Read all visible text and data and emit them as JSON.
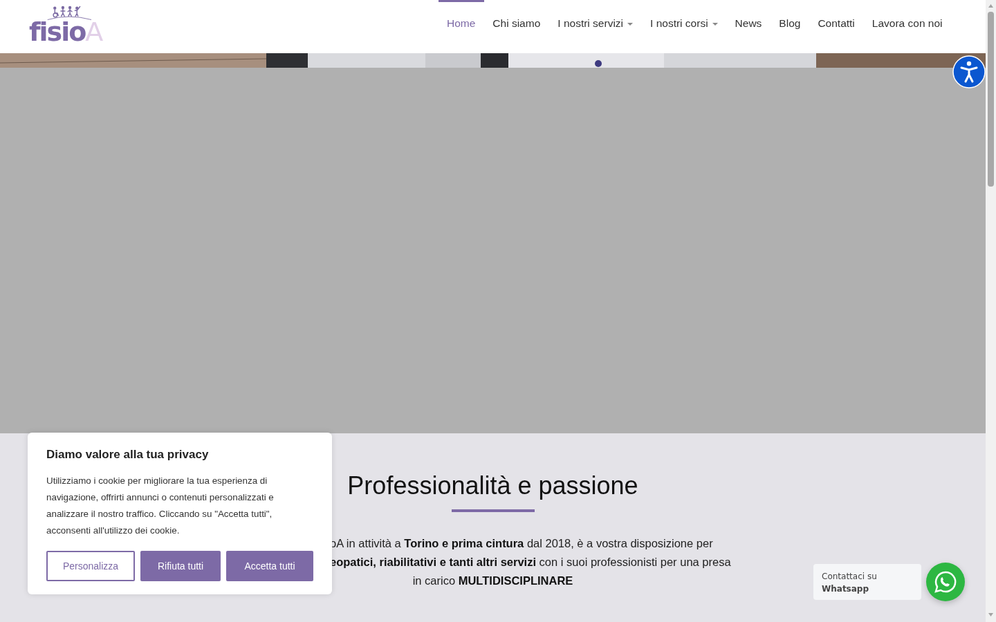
{
  "header": {
    "logo": {
      "text": "fisio",
      "accent": "A"
    },
    "nav": [
      {
        "label": "Home",
        "selected": true,
        "dropdown": false
      },
      {
        "label": "Chi siamo",
        "selected": false,
        "dropdown": false
      },
      {
        "label": "I nostri servizi",
        "selected": false,
        "dropdown": true
      },
      {
        "label": "I nostri corsi",
        "selected": false,
        "dropdown": true
      },
      {
        "label": "News",
        "selected": false,
        "dropdown": false
      },
      {
        "label": "Blog",
        "selected": false,
        "dropdown": false
      },
      {
        "label": "Contatti",
        "selected": false,
        "dropdown": false
      },
      {
        "label": "Lavora con noi",
        "selected": false,
        "dropdown": false
      }
    ]
  },
  "intro": {
    "heading": "Professionalità e passione",
    "lines": [
      "oA in attività a **Torino e prima cintura** dal 2018, è a vostra disposizione per",
      "**eopatici, riabilitativi e tanti altri servizi** con i suoi professionisti per una presa",
      "in carico **MULTIDISCIPLINARE**"
    ]
  },
  "cookie_banner": {
    "title": "Diamo valore alla tua privacy",
    "text": "Utilizziamo i cookie per migliorare la tua esperienza di navigazione, offrirti annunci o contenuti personalizzati e analizzare il nostro traffico. Cliccando su \"Accetta tutti\", acconsenti all'utilizzo dei cookie.",
    "buttons": [
      {
        "label": "Personalizza",
        "kind": "outline"
      },
      {
        "label": "Rifiuta tutti",
        "kind": "filled"
      },
      {
        "label": "Accetta tutti",
        "kind": "filled"
      }
    ]
  },
  "whatsapp": {
    "line1": "Contattaci su",
    "line2": "Whatsapp"
  }
}
